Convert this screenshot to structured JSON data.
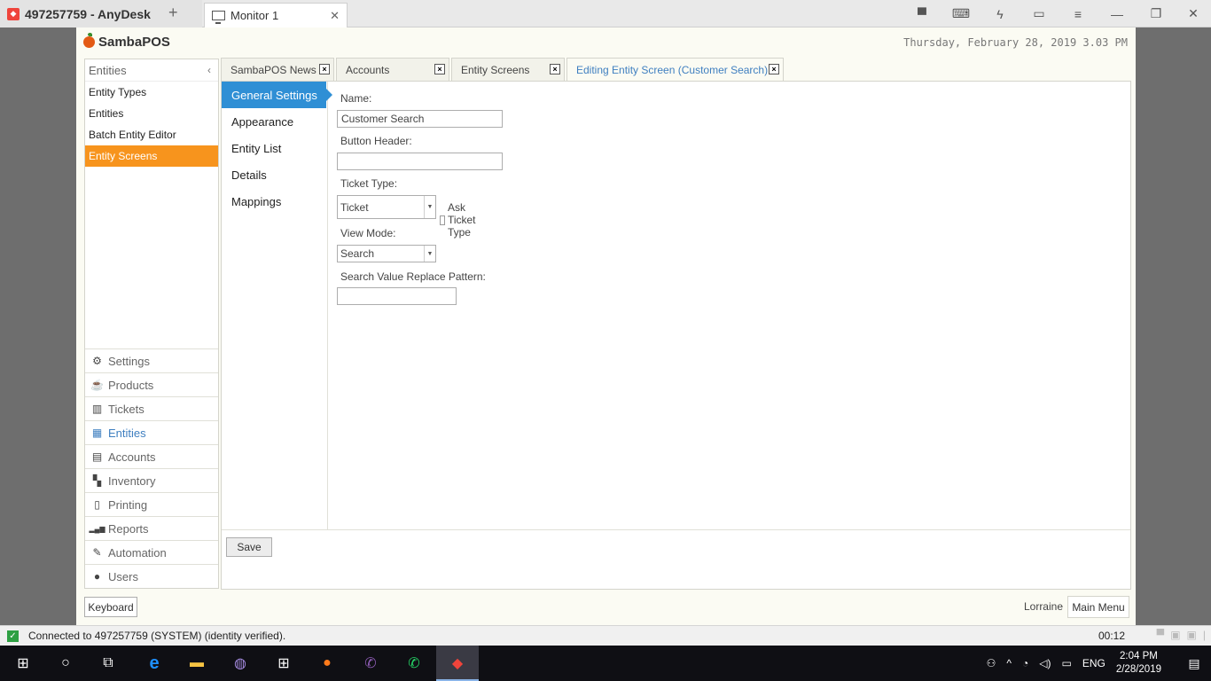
{
  "anydesk": {
    "session_label": "497257759 - AnyDesk",
    "new_tab": "+",
    "tab_label": "Monitor 1",
    "tab_close": "✕",
    "tools": {
      "chat": "▀",
      "keyboard": "⌨",
      "actions": "ϟ",
      "display": "▭",
      "menu": "≡",
      "minimize": "—",
      "maximize": "❐",
      "close": "✕"
    },
    "status_text": "Connected to 497257759 (SYSTEM) (identity verified).",
    "status_ok": "✓",
    "session_time": "00:12"
  },
  "samba": {
    "brand": "SambaPOS",
    "datetime": "Thursday, February 28, 2019 3.03 PM",
    "sidebar": {
      "title": "Entities",
      "collapse": "‹",
      "items": [
        {
          "label": "Entity Types"
        },
        {
          "label": "Entities"
        },
        {
          "label": "Batch Entity Editor"
        },
        {
          "label": "Entity Screens",
          "active": true
        }
      ]
    },
    "nav": [
      {
        "label": "Settings",
        "icon": "⚙"
      },
      {
        "label": "Products",
        "icon": "☕"
      },
      {
        "label": "Tickets",
        "icon": "▥"
      },
      {
        "label": "Entities",
        "icon": "▦",
        "active": true
      },
      {
        "label": "Accounts",
        "icon": "▤"
      },
      {
        "label": "Inventory",
        "icon": "▚"
      },
      {
        "label": "Printing",
        "icon": "▯"
      },
      {
        "label": "Reports",
        "icon": "▂▄▆"
      },
      {
        "label": "Automation",
        "icon": "✎"
      },
      {
        "label": "Users",
        "icon": "●"
      }
    ],
    "tabs": [
      {
        "label": "SambaPOS News"
      },
      {
        "label": "Accounts"
      },
      {
        "label": "Entity Screens"
      },
      {
        "label": "Editing Entity Screen (Customer Search)",
        "active": true
      }
    ],
    "tab_close": "×",
    "editor": {
      "sections": [
        {
          "label": "General Settings",
          "active": true
        },
        {
          "label": "Appearance"
        },
        {
          "label": "Entity List"
        },
        {
          "label": "Details"
        },
        {
          "label": "Mappings"
        }
      ],
      "fields": {
        "name_label": "Name:",
        "name_value": "Customer Search",
        "button_header_label": "Button Header:",
        "button_header_value": "",
        "ticket_type_label": "Ticket Type:",
        "ticket_type_value": "Ticket",
        "ask_ticket_type_label": "Ask Ticket Type",
        "ask_ticket_type_checked": false,
        "view_mode_label": "View Mode:",
        "view_mode_value": "Search",
        "search_pattern_label": "Search Value Replace Pattern:",
        "search_pattern_value": ""
      },
      "dropdown_arrow": "▼",
      "save_label": "Save"
    },
    "keyboard_label": "Keyboard",
    "user_name": "Lorraine",
    "main_menu_label": "Main Menu"
  },
  "taskbar": {
    "start": "⊞",
    "search": "○",
    "task_view": "⧉",
    "apps": [
      {
        "name": "edge",
        "glyph": "e",
        "color": "#1e90ff"
      },
      {
        "name": "file-explorer",
        "glyph": "▬",
        "color": "#f6c342"
      },
      {
        "name": "tor-browser",
        "glyph": "◍",
        "color": "#a58be0"
      },
      {
        "name": "store",
        "glyph": "⊞",
        "color": "#ffffff"
      },
      {
        "name": "firefox",
        "glyph": "●",
        "color": "#ff7a1a"
      },
      {
        "name": "viber",
        "glyph": "✆",
        "color": "#8f5db7"
      },
      {
        "name": "whatsapp",
        "glyph": "✆",
        "color": "#25d366"
      },
      {
        "name": "anydesk",
        "glyph": "◆",
        "color": "#ef443b",
        "active": true
      }
    ],
    "tray": {
      "people": "⚇",
      "chevron": "^",
      "network": "◔",
      "volume": "◁)",
      "battery": "▭",
      "language": "ENG",
      "time": "2:04 PM",
      "date": "2/28/2019",
      "notification": "▤"
    }
  }
}
